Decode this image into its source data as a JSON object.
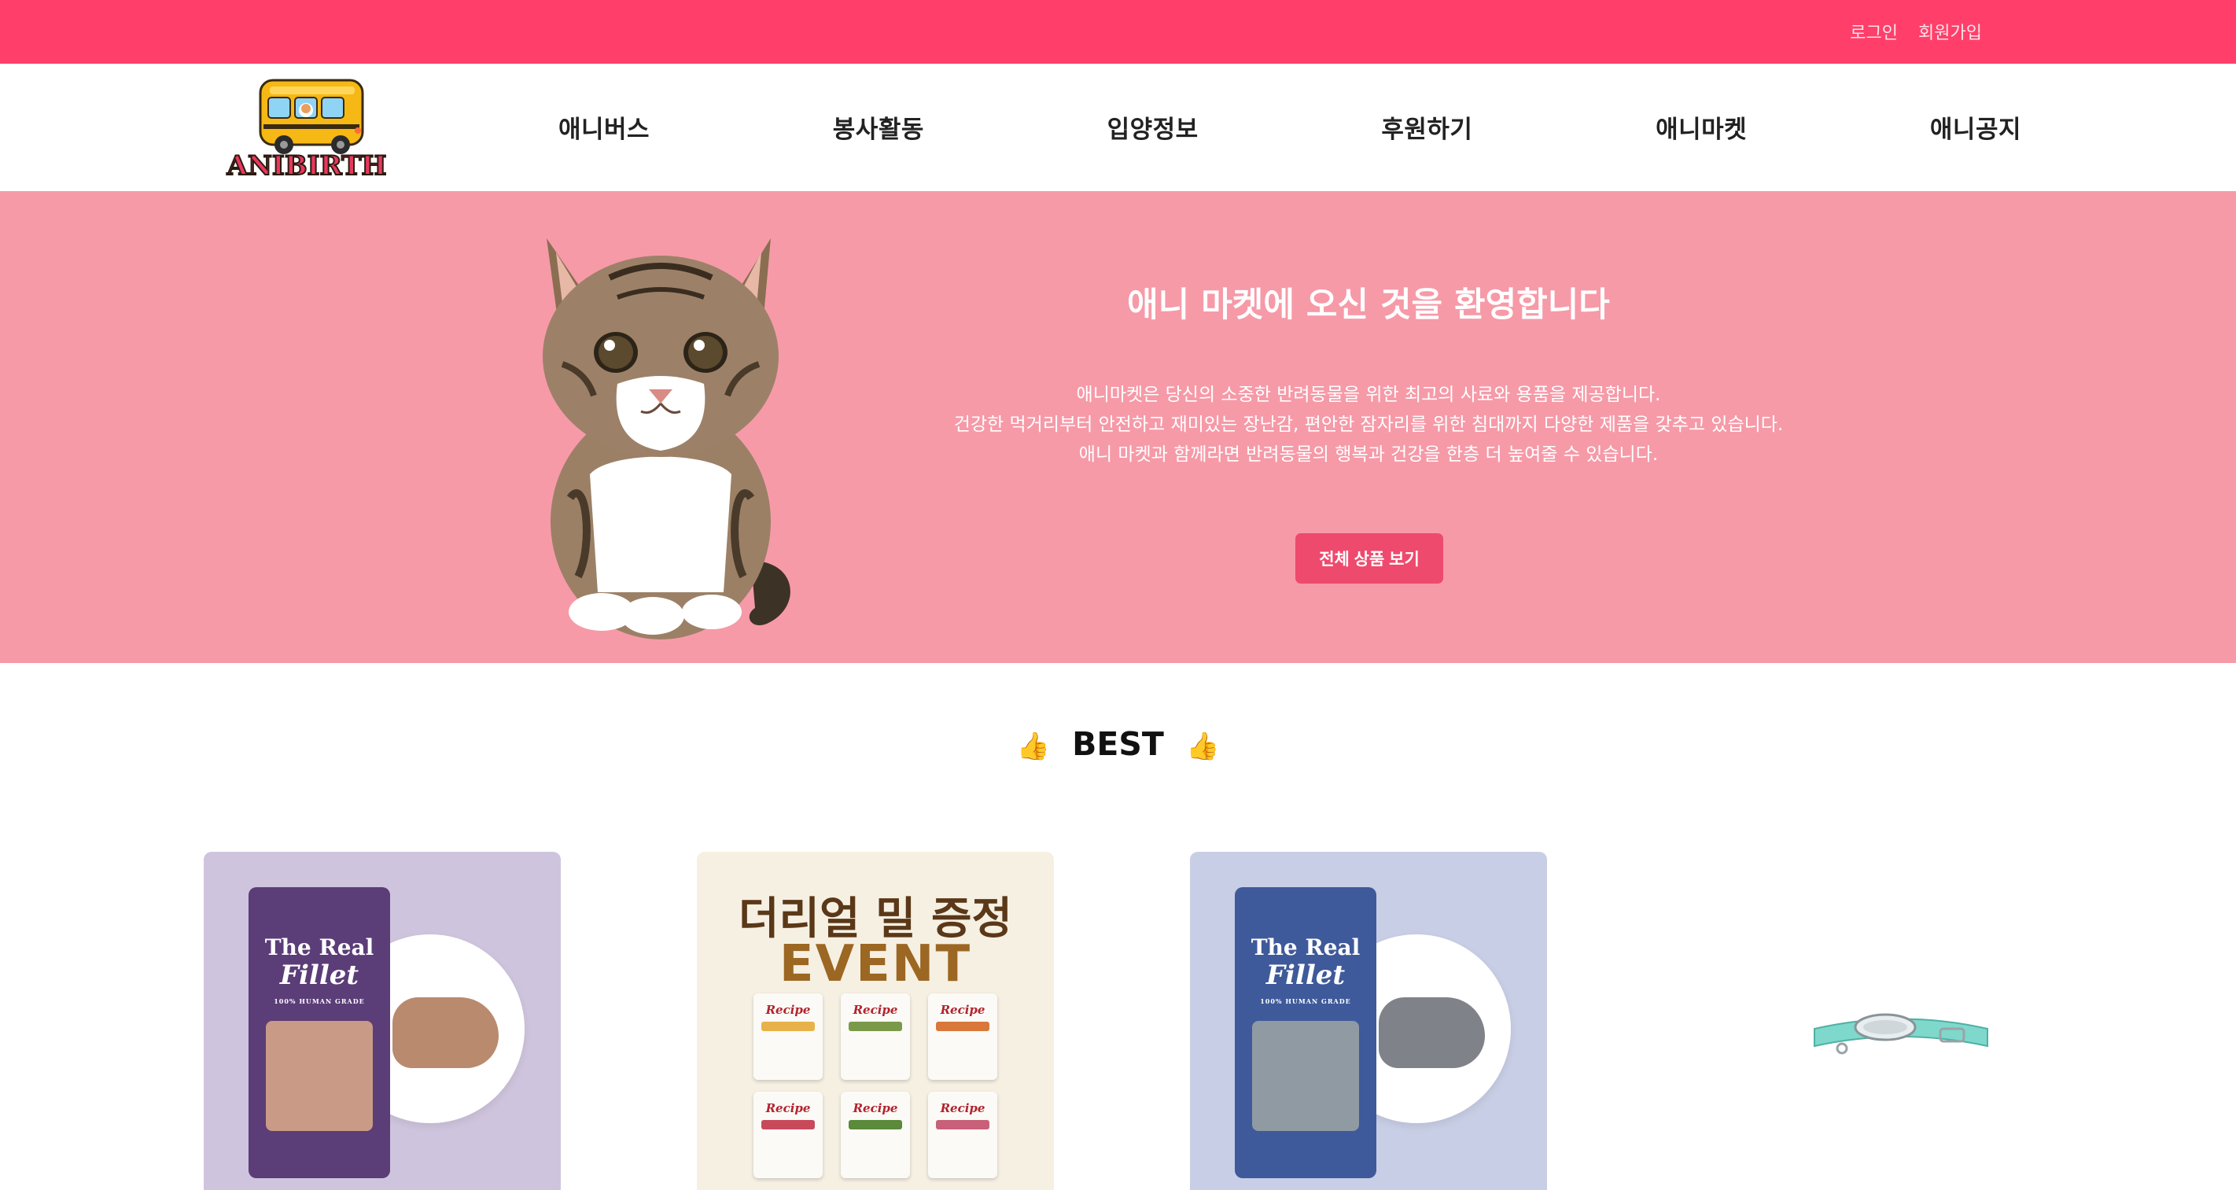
{
  "topbar": {
    "login": "로그인",
    "signup": "회원가입"
  },
  "brand": {
    "logo_text": "ANIBIRTH"
  },
  "nav": [
    "애니버스",
    "봉사활동",
    "입양정보",
    "후원하기",
    "애니마켓",
    "애니공지"
  ],
  "hero": {
    "title": "애니 마켓에 오신 것을 환영합니다",
    "lines": [
      "애니마켓은 당신의 소중한 반려동물을 위한 최고의 사료와 용품을 제공합니다.",
      "건강한 먹거리부터 안전하고 재미있는 장난감, 편안한 잠자리를 위한 침대까지 다양한 제품을 갖추고 있습니다.",
      "애니 마켓과 함께라면 반려동물의 행복과 건강을 한층 더 높여줄 수 있습니다."
    ],
    "cta": "전체 상품 보기"
  },
  "best": {
    "title": "BEST",
    "icon": "👍"
  },
  "products": {
    "p1": {
      "brand": "The Real",
      "name": "Fillet",
      "grade": "100% HUMAN GRADE"
    },
    "p2": {
      "title": "더리얼 밀 증정",
      "sub": "EVENT",
      "pouch_label": "Recipe"
    },
    "p3": {
      "brand": "The Real",
      "name": "Fillet",
      "grade": "100% HUMAN GRADE"
    }
  },
  "colors": {
    "topbar": "#ff3f6a",
    "hero": "#f69aa8",
    "cta": "#ee4a6d"
  }
}
